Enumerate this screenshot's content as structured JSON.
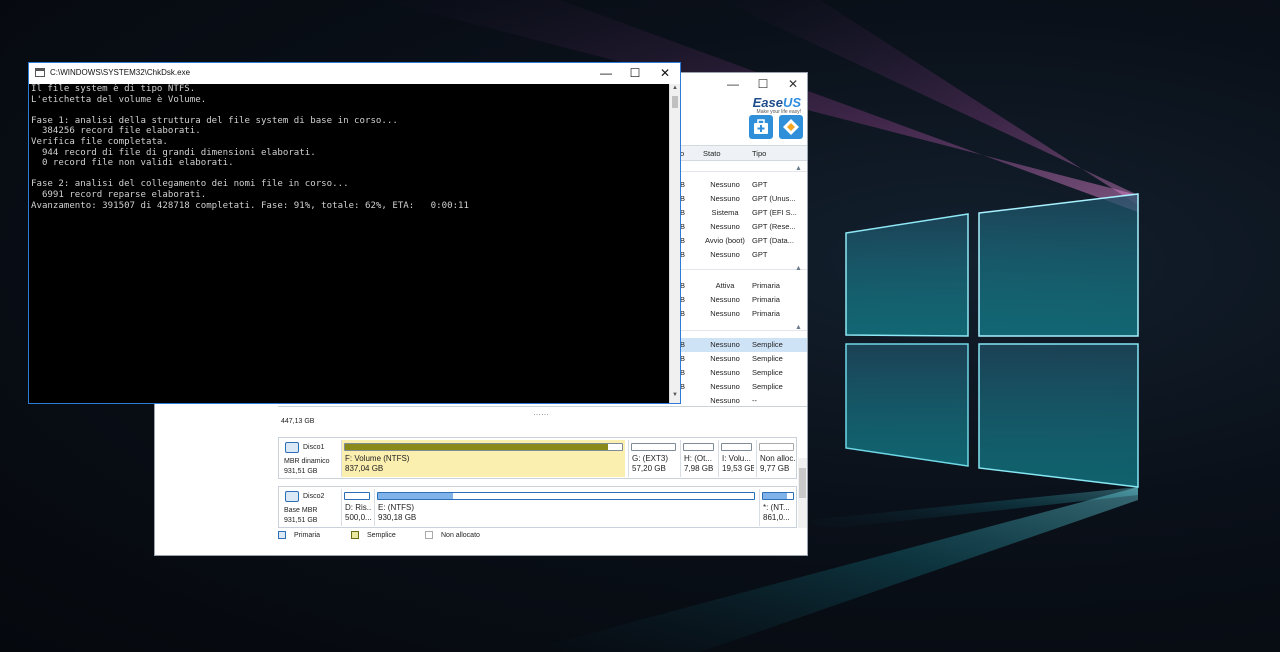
{
  "console": {
    "title": "C:\\WINDOWS\\SYSTEM32\\ChkDsk.exe",
    "lines": [
      "Il file system è di tipo NTFS.",
      "L'etichetta del volume è Volume.",
      "",
      "Fase 1: analisi della struttura del file system di base in corso...",
      "  384256 record file elaborati.",
      "Verifica file completata.",
      "  944 record di file di grandi dimensioni elaborati.",
      "  0 record file non validi elaborati.",
      "",
      "Fase 2: analisi del collegamento dei nomi file in corso...",
      "  6991 record reparse elaborati.",
      "Avanzamento: 391507 di 428718 completati. Fase: 91%, totale: 62%, ETA:   0:00:11"
    ],
    "minimize_glyph": "—",
    "maximize_glyph": "☐",
    "close_glyph": "✕"
  },
  "easeus": {
    "logo_prefix": "Ease",
    "logo_suffix": "US",
    "logo_tagline": "Make your life easy!",
    "minimize_glyph": "—",
    "maximize_glyph": "☐",
    "close_glyph": "✕",
    "table": {
      "col_cut": "o",
      "col_stato": "Stato",
      "col_tipo": "Tipo",
      "rows": [
        {
          "cut": "B",
          "stato": "Nessuno",
          "tipo": "GPT"
        },
        {
          "cut": "B",
          "stato": "Nessuno",
          "tipo": "GPT (Unus..."
        },
        {
          "cut": "B",
          "stato": "Sistema",
          "tipo": "GPT (EFI S..."
        },
        {
          "cut": "B",
          "stato": "Nessuno",
          "tipo": "GPT (Rese..."
        },
        {
          "cut": "B",
          "stato": "Avvio (boot)",
          "tipo": "GPT (Data..."
        },
        {
          "cut": "B",
          "stato": "Nessuno",
          "tipo": "GPT"
        },
        {
          "cut": "B",
          "stato": "Attiva",
          "tipo": "Primaria"
        },
        {
          "cut": "B",
          "stato": "Nessuno",
          "tipo": "Primaria"
        },
        {
          "cut": "B",
          "stato": "Nessuno",
          "tipo": "Primaria"
        },
        {
          "cut": "B",
          "stato": "Nessuno",
          "tipo": "Semplice"
        },
        {
          "cut": "B",
          "stato": "Nessuno",
          "tipo": "Semplice"
        },
        {
          "cut": "B",
          "stato": "Nessuno",
          "tipo": "Semplice"
        },
        {
          "cut": "B",
          "stato": "Nessuno",
          "tipo": "Semplice"
        },
        {
          "cut": "",
          "stato": "Nessuno",
          "tipo": "--"
        }
      ]
    },
    "cut_size": "447,13 GB",
    "disks": [
      {
        "name": "Disco1",
        "type": "MBR dinamico",
        "size": "931,51 GB",
        "partitions": [
          {
            "label": "F: Volume (NTFS)",
            "size": "837,04 GB",
            "fill": 0.95
          },
          {
            "label": "G: (EXT3)",
            "size": "57,20 GB",
            "fill": 0
          },
          {
            "label": "H: (Ot...",
            "size": "7,98 GB",
            "fill": 0
          },
          {
            "label": "I: Volu...",
            "size": "19,53 GB",
            "fill": 0
          },
          {
            "label": "Non alloc...",
            "size": "9,77 GB",
            "fill": 0
          }
        ]
      },
      {
        "name": "Disco2",
        "type": "Base MBR",
        "size": "931,51 GB",
        "partitions": [
          {
            "label": "D: Ris...",
            "size": "500,0...",
            "fill": 0
          },
          {
            "label": "E: (NTFS)",
            "size": "930,18 GB",
            "fill": 0.2
          },
          {
            "label": "*: (NT...",
            "size": "861,0...",
            "fill": 0.8
          }
        ]
      }
    ],
    "legend": {
      "primary": "Primaria",
      "simple": "Semplice",
      "unallocated": "Non allocato"
    },
    "colors": {
      "accent": "#2e8de0",
      "selected_row": "#cfe3f7",
      "selected_partition": "#fbefb0",
      "volume_fill": "#8a8a1a",
      "ntfs_fill": "#7fb3ea"
    }
  }
}
